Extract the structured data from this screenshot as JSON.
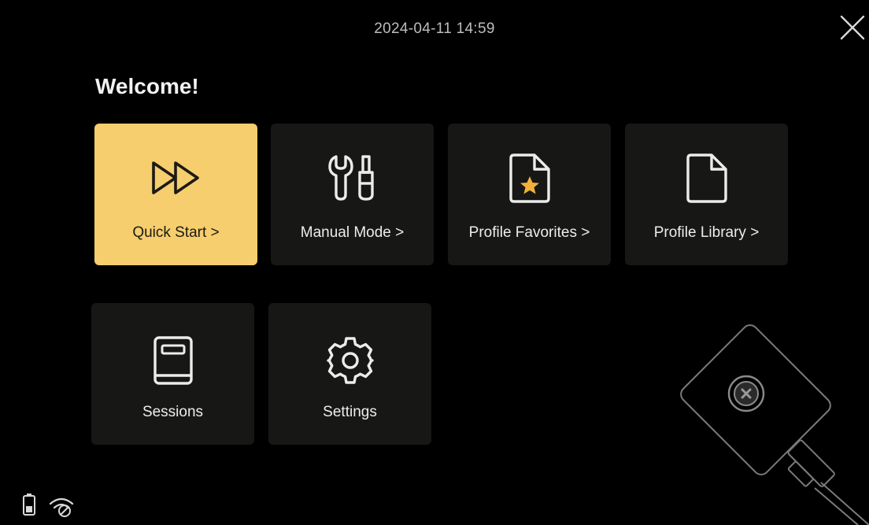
{
  "header": {
    "datetime": "2024-04-11 14:59"
  },
  "welcome": "Welcome!",
  "tiles": [
    {
      "label": "Quick Start >",
      "icon": "fast-forward-icon",
      "active": true
    },
    {
      "label": "Manual Mode >",
      "icon": "tools-icon",
      "active": false
    },
    {
      "label": "Profile Favorites >",
      "icon": "file-star-icon",
      "active": false
    },
    {
      "label": "Profile Library >",
      "icon": "file-icon",
      "active": false
    },
    {
      "label": "Sessions",
      "icon": "book-icon",
      "active": false
    },
    {
      "label": "Settings",
      "icon": "gear-icon",
      "active": false
    }
  ],
  "status": {
    "icons": [
      "battery-icon",
      "wifi-off-icon"
    ]
  },
  "colors": {
    "background": "#000000",
    "tile": "#171716",
    "accent": "#f6ce6e",
    "star": "#f2b23a"
  }
}
